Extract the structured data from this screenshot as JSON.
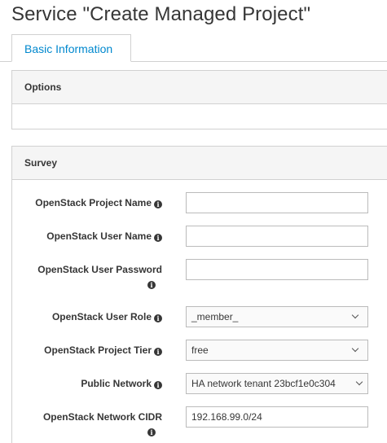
{
  "page": {
    "title": "Service \"Create Managed Project\""
  },
  "tabs": [
    {
      "label": "Basic Information"
    }
  ],
  "options_panel": {
    "heading": "Options"
  },
  "survey_panel": {
    "heading": "Survey"
  },
  "fields": {
    "project_name": {
      "label": "OpenStack Project Name",
      "value": ""
    },
    "user_name": {
      "label": "OpenStack User Name",
      "value": ""
    },
    "user_password": {
      "label": "OpenStack User Password",
      "value": ""
    },
    "user_role": {
      "label": "OpenStack User Role",
      "value": "_member_"
    },
    "project_tier": {
      "label": "OpenStack Project Tier",
      "value": "free"
    },
    "public_network": {
      "label": "Public Network",
      "value": "HA network tenant 23bcf1e0c304"
    },
    "network_cidr": {
      "label": "OpenStack Network CIDR",
      "value": "192.168.99.0/24"
    }
  },
  "icons": {
    "info": "info-circle-icon",
    "caret": "chevron-down-icon"
  },
  "colors": {
    "accent": "#0088ce",
    "panel_heading_bg": "#f5f5f5",
    "border": "#d1d1d1"
  }
}
